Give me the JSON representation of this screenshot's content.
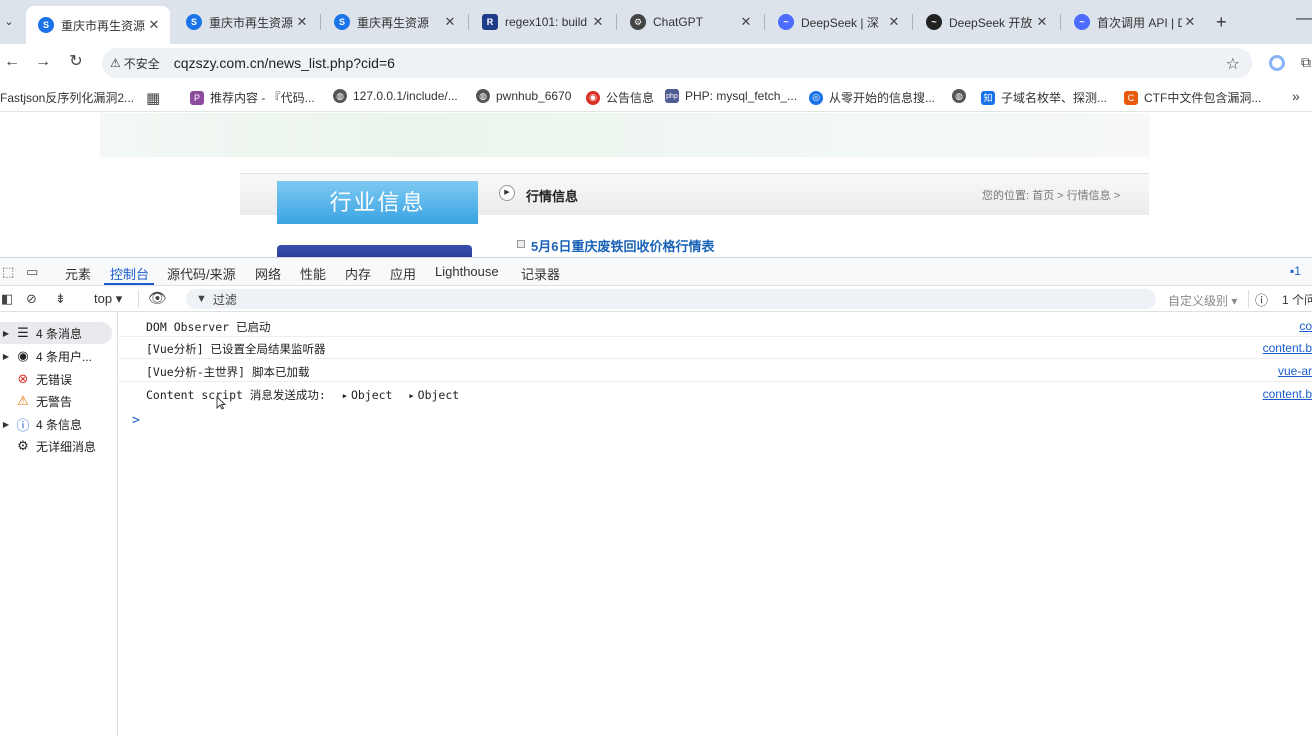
{
  "tabs": [
    {
      "title": "重庆市再生资源",
      "active": true,
      "color": "#1a73e8"
    },
    {
      "title": "重庆市再生资源",
      "active": false,
      "color": "#1a73e8"
    },
    {
      "title": "重庆再生资源",
      "active": false,
      "color": "#1a73e8"
    },
    {
      "title": "regex101: build",
      "active": false,
      "color": "#1f3c88"
    },
    {
      "title": "ChatGPT",
      "active": false,
      "color": "#444444"
    },
    {
      "title": "DeepSeek | 深",
      "active": false,
      "color": "#4d6bfe"
    },
    {
      "title": "DeepSeek 开放",
      "active": false,
      "color": "#222222"
    },
    {
      "title": "首次调用 API | D",
      "active": false,
      "color": "#4d6bfe"
    }
  ],
  "toolbar": {
    "insecure_label": "不安全",
    "url": "cqzszy.com.cn/news_list.php?cid=6"
  },
  "bookmarks": [
    {
      "label": "Fastjson反序列化漏洞2...",
      "color": ""
    },
    {
      "label": "",
      "color": ""
    },
    {
      "label": "推荐内容 - 『代码...",
      "color": "#8b4a9c"
    },
    {
      "label": "127.0.0.1/include/...",
      "color": "#555555"
    },
    {
      "label": "pwnhub_6670",
      "color": "#555555"
    },
    {
      "label": "公告信息",
      "color": "#d93025"
    },
    {
      "label": "PHP: mysql_fetch_...",
      "color": "#4f5b93"
    },
    {
      "label": "从零开始的信息搜...",
      "color": "#1a73e8"
    },
    {
      "label": "",
      "color": "#555555"
    },
    {
      "label": "子域名枚举、探测...",
      "color": "#1a73e8"
    },
    {
      "label": "CTF中文件包含漏洞...",
      "color": "#e8590c"
    }
  ],
  "webpage": {
    "side_title": "行业信息",
    "section_title": "行情信息",
    "breadcrumb": "您的位置:  首页 > 行情信息 >",
    "news_item": "5月6日重庆废铁回收价格行情表"
  },
  "devtools": {
    "tabs": [
      "元素",
      "控制台",
      "源代码/来源",
      "网络",
      "性能",
      "内存",
      "应用",
      "Lighthouse",
      "记录器"
    ],
    "active_tab": "控制台",
    "badge": "1",
    "context": "top",
    "filter_placeholder": "过滤",
    "levels": "自定义级别",
    "issues": "1 个问"
  },
  "console_sidebar": [
    {
      "label": "4 条消息",
      "icon": "list-icon",
      "expandable": true,
      "selected": true
    },
    {
      "label": "4 条用户...",
      "icon": "user-icon",
      "expandable": true,
      "selected": false
    },
    {
      "label": "无错误",
      "icon": "error-icon",
      "expandable": false,
      "selected": false
    },
    {
      "label": "无警告",
      "icon": "warning-icon",
      "expandable": false,
      "selected": false
    },
    {
      "label": "4 条信息",
      "icon": "info-icon",
      "expandable": true,
      "selected": false
    },
    {
      "label": "无详细消息",
      "icon": "verbose-icon",
      "expandable": false,
      "selected": false
    }
  ],
  "console_logs": [
    {
      "message": "DOM Observer 已启动",
      "source": "co"
    },
    {
      "message": "[Vue分析] 已设置全局结果监听器",
      "source": "content.b"
    },
    {
      "message": "[Vue分析-主世界] 脚本已加载",
      "source": "vue-ar"
    },
    {
      "message": "Content script 消息发送成功:",
      "source": "content.b",
      "objects": [
        "Object",
        "Object"
      ]
    }
  ],
  "console_prompt": ">"
}
